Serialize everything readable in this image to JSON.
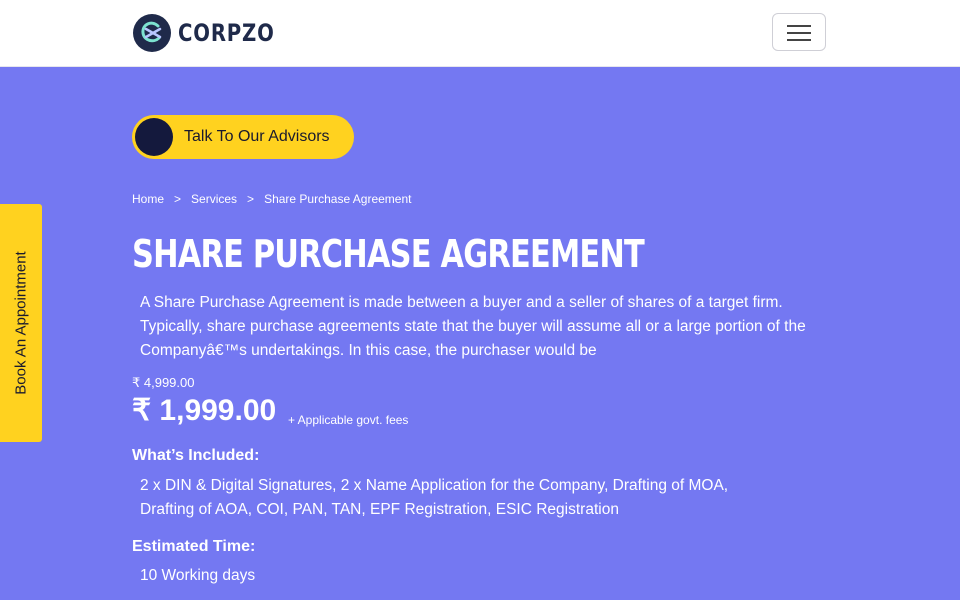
{
  "brand": {
    "name": "CORPZO",
    "logo_icon": "corpzo-logo-icon"
  },
  "navbar": {
    "menu_icon": "hamburger-menu-icon"
  },
  "cta": {
    "label": "Talk To Our Advisors"
  },
  "side_tab": {
    "label": "Book An Appointment"
  },
  "breadcrumb": {
    "items": [
      "Home",
      "Services",
      "Share Purchase Agreement"
    ],
    "separator": ">"
  },
  "page": {
    "title": "SHARE PURCHASE AGREEMENT",
    "description": "A Share Purchase Agreement is made between a buyer and a seller of shares of a target firm. Typically, share purchase agreements state that the buyer will assume all or a large portion of the Companyâ€™s undertakings. In this case, the purchaser would be"
  },
  "pricing": {
    "original_price": "₹ 4,999.00",
    "current_price": "₹ 1,999.00",
    "fees_note": "+ Applicable govt. fees"
  },
  "included": {
    "heading": "What’s Included:",
    "text": "2 x DIN & Digital Signatures, 2 x Name Application for the Company, Drafting of MOA, Drafting of AOA, COI, PAN, TAN, EPF Registration, ESIC Registration"
  },
  "estimated_time": {
    "heading": "Estimated Time:",
    "value": "10 Working days"
  },
  "colors": {
    "background": "#7478f2",
    "accent_yellow": "#ffd21f",
    "navy": "#14193d"
  }
}
